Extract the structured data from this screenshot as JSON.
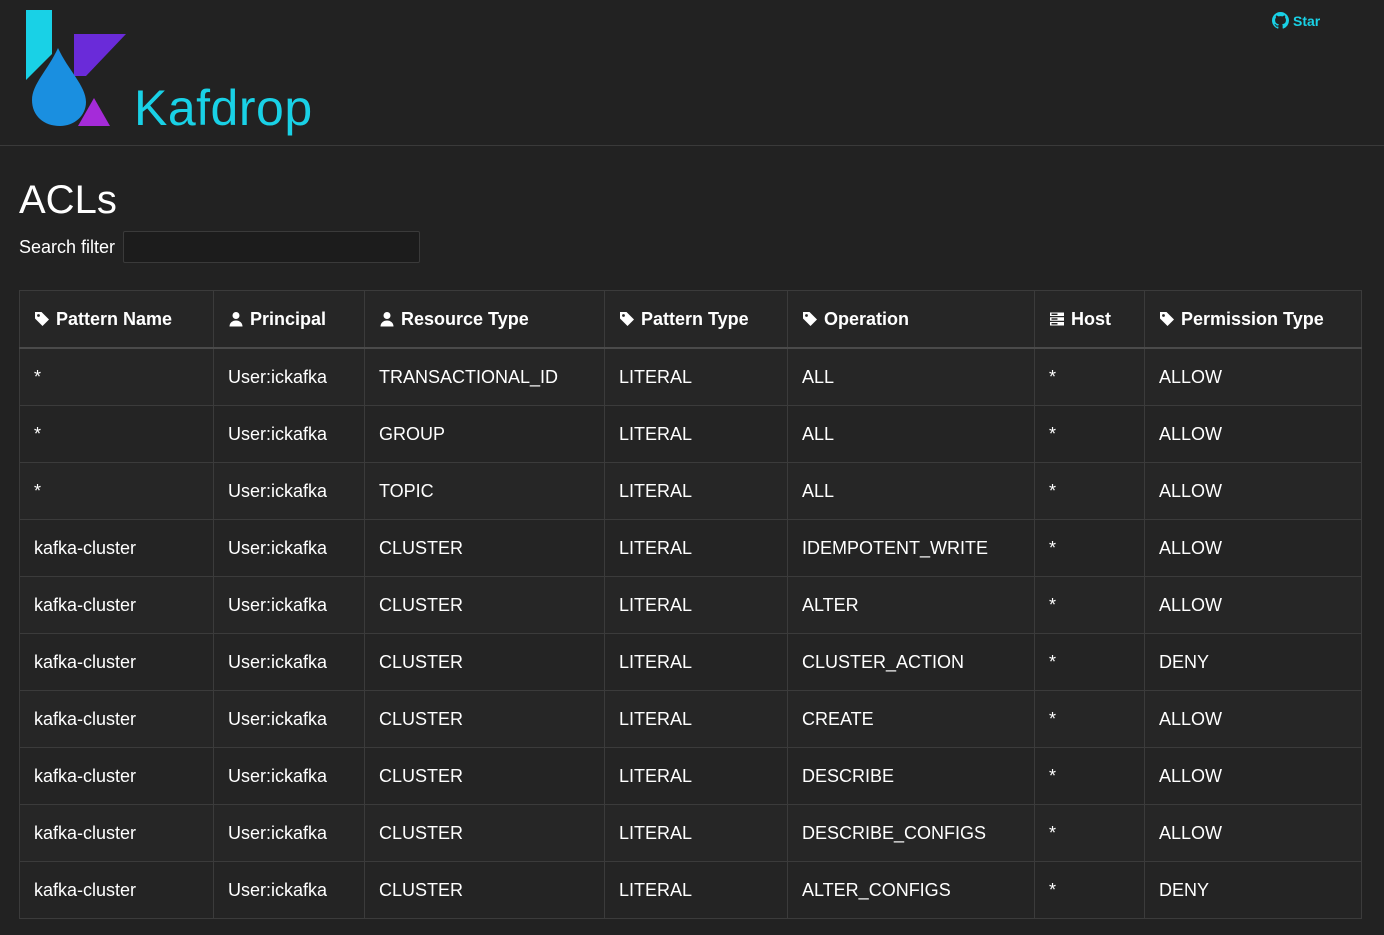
{
  "header": {
    "brand": "Kafdrop",
    "star_label": "Star"
  },
  "page": {
    "title": "ACLs",
    "search_label": "Search filter",
    "search_value": "",
    "search_placeholder": ""
  },
  "colors": {
    "accent": "#19d1e6",
    "background": "#222222"
  },
  "table": {
    "columns": [
      {
        "key": "pattern_name",
        "label": "Pattern Name",
        "icon": "tag-icon"
      },
      {
        "key": "principal",
        "label": "Principal",
        "icon": "user-icon"
      },
      {
        "key": "resource_type",
        "label": "Resource Type",
        "icon": "user-icon"
      },
      {
        "key": "pattern_type",
        "label": "Pattern Type",
        "icon": "tag-icon"
      },
      {
        "key": "operation",
        "label": "Operation",
        "icon": "tag-icon"
      },
      {
        "key": "host",
        "label": "Host",
        "icon": "server-icon"
      },
      {
        "key": "permission_type",
        "label": "Permission Type",
        "icon": "tag-icon"
      }
    ],
    "rows": [
      {
        "pattern_name": "*",
        "principal": "User:ickafka",
        "resource_type": "TRANSACTIONAL_ID",
        "pattern_type": "LITERAL",
        "operation": "ALL",
        "host": "*",
        "permission_type": "ALLOW"
      },
      {
        "pattern_name": "*",
        "principal": "User:ickafka",
        "resource_type": "GROUP",
        "pattern_type": "LITERAL",
        "operation": "ALL",
        "host": "*",
        "permission_type": "ALLOW"
      },
      {
        "pattern_name": "*",
        "principal": "User:ickafka",
        "resource_type": "TOPIC",
        "pattern_type": "LITERAL",
        "operation": "ALL",
        "host": "*",
        "permission_type": "ALLOW"
      },
      {
        "pattern_name": "kafka-cluster",
        "principal": "User:ickafka",
        "resource_type": "CLUSTER",
        "pattern_type": "LITERAL",
        "operation": "IDEMPOTENT_WRITE",
        "host": "*",
        "permission_type": "ALLOW"
      },
      {
        "pattern_name": "kafka-cluster",
        "principal": "User:ickafka",
        "resource_type": "CLUSTER",
        "pattern_type": "LITERAL",
        "operation": "ALTER",
        "host": "*",
        "permission_type": "ALLOW"
      },
      {
        "pattern_name": "kafka-cluster",
        "principal": "User:ickafka",
        "resource_type": "CLUSTER",
        "pattern_type": "LITERAL",
        "operation": "CLUSTER_ACTION",
        "host": "*",
        "permission_type": "DENY"
      },
      {
        "pattern_name": "kafka-cluster",
        "principal": "User:ickafka",
        "resource_type": "CLUSTER",
        "pattern_type": "LITERAL",
        "operation": "CREATE",
        "host": "*",
        "permission_type": "ALLOW"
      },
      {
        "pattern_name": "kafka-cluster",
        "principal": "User:ickafka",
        "resource_type": "CLUSTER",
        "pattern_type": "LITERAL",
        "operation": "DESCRIBE",
        "host": "*",
        "permission_type": "ALLOW"
      },
      {
        "pattern_name": "kafka-cluster",
        "principal": "User:ickafka",
        "resource_type": "CLUSTER",
        "pattern_type": "LITERAL",
        "operation": "DESCRIBE_CONFIGS",
        "host": "*",
        "permission_type": "ALLOW"
      },
      {
        "pattern_name": "kafka-cluster",
        "principal": "User:ickafka",
        "resource_type": "CLUSTER",
        "pattern_type": "LITERAL",
        "operation": "ALTER_CONFIGS",
        "host": "*",
        "permission_type": "DENY"
      }
    ]
  }
}
